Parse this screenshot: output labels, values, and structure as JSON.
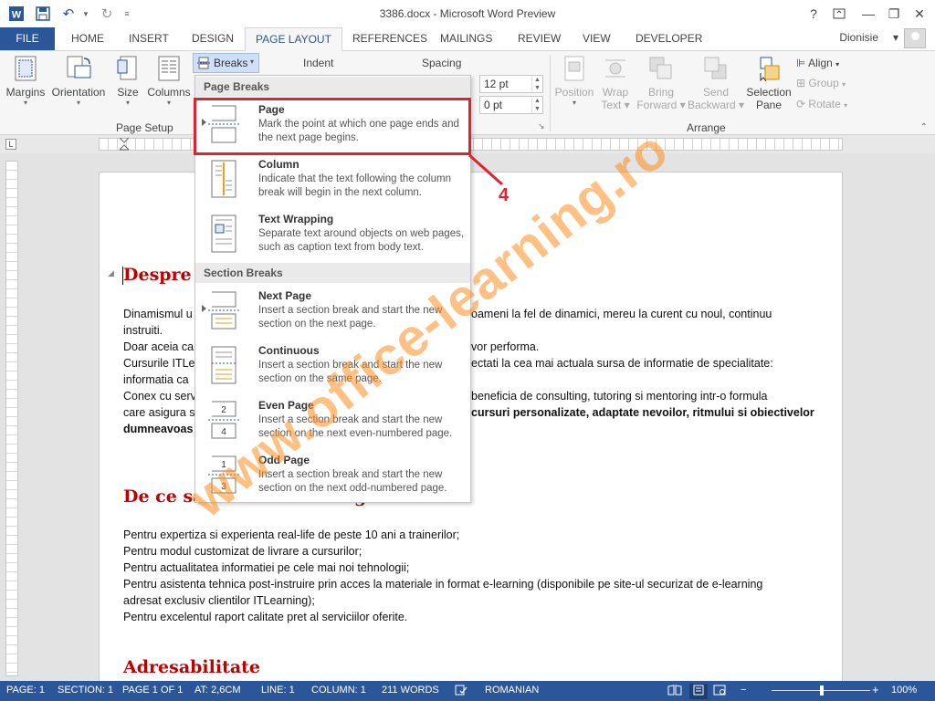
{
  "window": {
    "title": "3386.docx - Microsoft Word Preview",
    "help": "?",
    "minimize": "—",
    "restore": "❐",
    "close": "✕"
  },
  "tabs": {
    "file": "FILE",
    "items": [
      "HOME",
      "INSERT",
      "DESIGN",
      "PAGE LAYOUT",
      "REFERENCES",
      "MAILINGS",
      "REVIEW",
      "VIEW",
      "DEVELOPER"
    ],
    "active": "PAGE LAYOUT",
    "user": "Dionisie"
  },
  "ribbon": {
    "margins": "Margins",
    "orientation": "Orientation",
    "size": "Size",
    "columns": "Columns",
    "breaks": "Breaks",
    "page_setup": "Page Setup",
    "indent": "Indent",
    "spacing": "Spacing",
    "spacing_before": "12 pt",
    "spacing_after": "0 pt",
    "position": "Position",
    "wrap_text_1": "Wrap",
    "wrap_text_2": "Text",
    "bring_forward_1": "Bring",
    "bring_forward_2": "Forward",
    "send_backward_1": "Send",
    "send_backward_2": "Backward",
    "selection_pane_1": "Selection",
    "selection_pane_2": "Pane",
    "align": "Align",
    "group": "Group",
    "rotate": "Rotate",
    "arrange": "Arrange"
  },
  "breaks_menu": {
    "page_breaks_header": "Page Breaks",
    "section_breaks_header": "Section Breaks",
    "items": [
      {
        "title": "Page",
        "desc": "Mark the point at which one page ends and the next page begins."
      },
      {
        "title": "Column",
        "desc": "Indicate that the text following the column break will begin in the next column."
      },
      {
        "title": "Text Wrapping",
        "desc": "Separate text around objects on web pages, such as caption text from body text."
      },
      {
        "title": "Next Page",
        "desc": "Insert a section break and start the new section on the next page."
      },
      {
        "title": "Continuous",
        "desc": "Insert a section break and start the new section on the same page."
      },
      {
        "title": "Even Page",
        "desc": "Insert a section break and start the new section on the next even-numbered page."
      },
      {
        "title": "Odd Page",
        "desc": "Insert a section break and start the new section on the next odd-numbered page."
      }
    ]
  },
  "document": {
    "heading1": "Despre c",
    "para1": [
      {
        "left": "Dinamismul u",
        "right": "oameni la fel de dinamici, mereu la curent cu noul, continuu"
      },
      {
        "left": "instruiti.",
        "right": ""
      },
      {
        "left": "Doar aceia ca",
        "right": "vor performa."
      },
      {
        "left": "Cursurile ITLe",
        "right": "ectati la cea mai actuala sursa de informatie de specialitate:"
      },
      {
        "left": "informatia ca",
        "right": ""
      },
      {
        "left": "Conex cu serv",
        "right": "beneficia de consulting, tutoring si mentoring intr-o formula"
      },
      {
        "left": "care asigura s",
        "right": "cursuri personalizate, adaptate nevoilor, ritmului si obiectivelor"
      },
      {
        "left": "dumneavoas",
        "right": ""
      }
    ],
    "heading2": "De ce sa",
    "heading2_right": "g",
    "para2": [
      "Pentru expertiza si experienta real-life de peste 10 ani a trainerilor;",
      "Pentru modul customizat de livrare a cursurilor;",
      "Pentru actualitatea informatiei pe cele mai noi tehnologii;",
      "Pentru asistenta tehnica post-instruire prin acces la materiale in format e-learning (disponibile pe site-ul securizat de e-learning",
      "adresat exclusiv clientilor ITLearning);",
      "Pentru excelentul raport calitate pret al serviciilor oferite."
    ],
    "heading3": "Adresabilitate"
  },
  "status": {
    "page": "PAGE: 1",
    "section": "SECTION: 1",
    "page_of": "PAGE 1 OF 1",
    "at": "AT: 2,6CM",
    "line": "LINE: 1",
    "column": "COLUMN: 1",
    "words": "211 WORDS",
    "language": "ROMANIAN",
    "zoom": "100%"
  },
  "annotation": {
    "step_number": "4"
  },
  "watermark": "www.office-learning.ro",
  "colors": {
    "word_blue": "#2b579a",
    "heading_red": "#c00000",
    "annotation_red": "#e0232e",
    "watermark_orange": "#ff8c1e"
  }
}
